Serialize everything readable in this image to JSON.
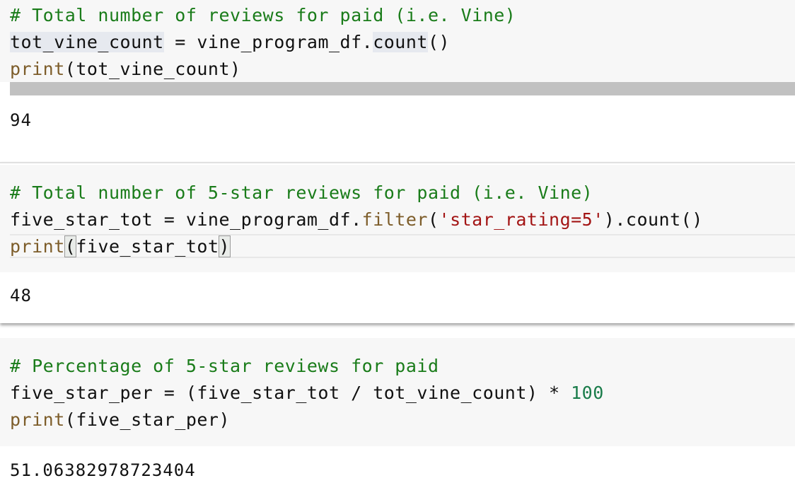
{
  "cells": [
    {
      "comment": "# Total number of reviews for paid (i.e. Vine)",
      "line2": {
        "var": "tot_vine_count",
        "eq": " = ",
        "obj": "vine_program_df.",
        "method": "count",
        "tail": "()"
      },
      "line3": {
        "fn": "print",
        "args": "(tot_vine_count)"
      },
      "output": "94"
    },
    {
      "comment": "# Total number of 5-star reviews for paid (i.e. Vine)",
      "line2": {
        "pre": "five_star_tot = vine_program_df.",
        "method": "filter",
        "open": "(",
        "str": "'star_rating=5'",
        "tail": ").count()"
      },
      "line3": {
        "fn": "print",
        "open": "(",
        "args": "five_star_tot",
        "close": ")"
      },
      "output": "48"
    },
    {
      "comment": "# Percentage of 5-star reviews for paid",
      "line2": {
        "pre": "five_star_per = (five_star_tot / tot_vine_count) * ",
        "num": "100"
      },
      "line3": {
        "fn": "print",
        "args": "(five_star_per)"
      },
      "output": "51.06382978723404"
    }
  ]
}
